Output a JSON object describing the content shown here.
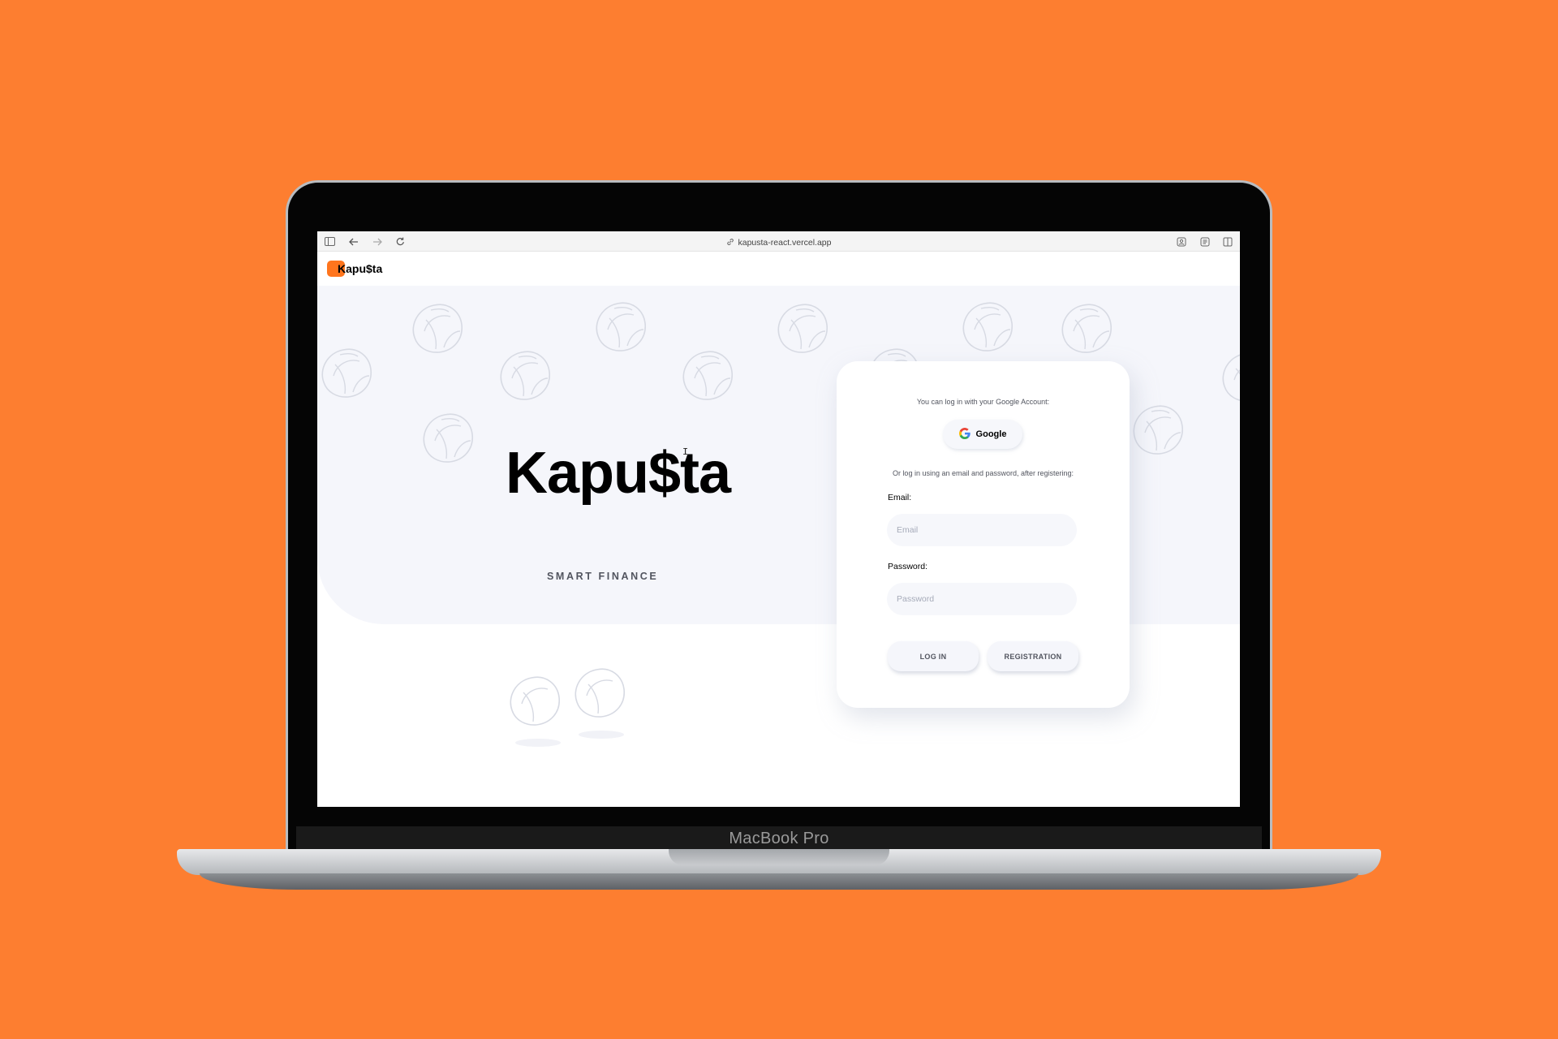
{
  "device": {
    "model_label": "MacBook Pro"
  },
  "browser": {
    "url": "kapusta-react.vercel.app",
    "icons": [
      "sidebar-icon",
      "back-arrow-icon",
      "forward-arrow-icon",
      "reload-icon",
      "link-icon",
      "extension-icon",
      "reader-icon",
      "split-view-icon"
    ]
  },
  "header": {
    "logo_text": "Kapu$ta"
  },
  "hero": {
    "title": "Kapu$ta",
    "subtitle": "SMART FINANCE"
  },
  "auth": {
    "google_hint": "You can log in with your Google Account:",
    "google_button": "Google",
    "email_hint": "Or log in using an email and password, after registering:",
    "email_label": "Email:",
    "email_placeholder": "Email",
    "password_label": "Password:",
    "password_placeholder": "Password",
    "login_button": "LOG IN",
    "registration_button": "REGISTRATION"
  },
  "colors": {
    "background": "#FD7E30",
    "accent": "#FF751D",
    "hero_bg": "#F5F6FB",
    "text_secondary": "#52555F"
  }
}
